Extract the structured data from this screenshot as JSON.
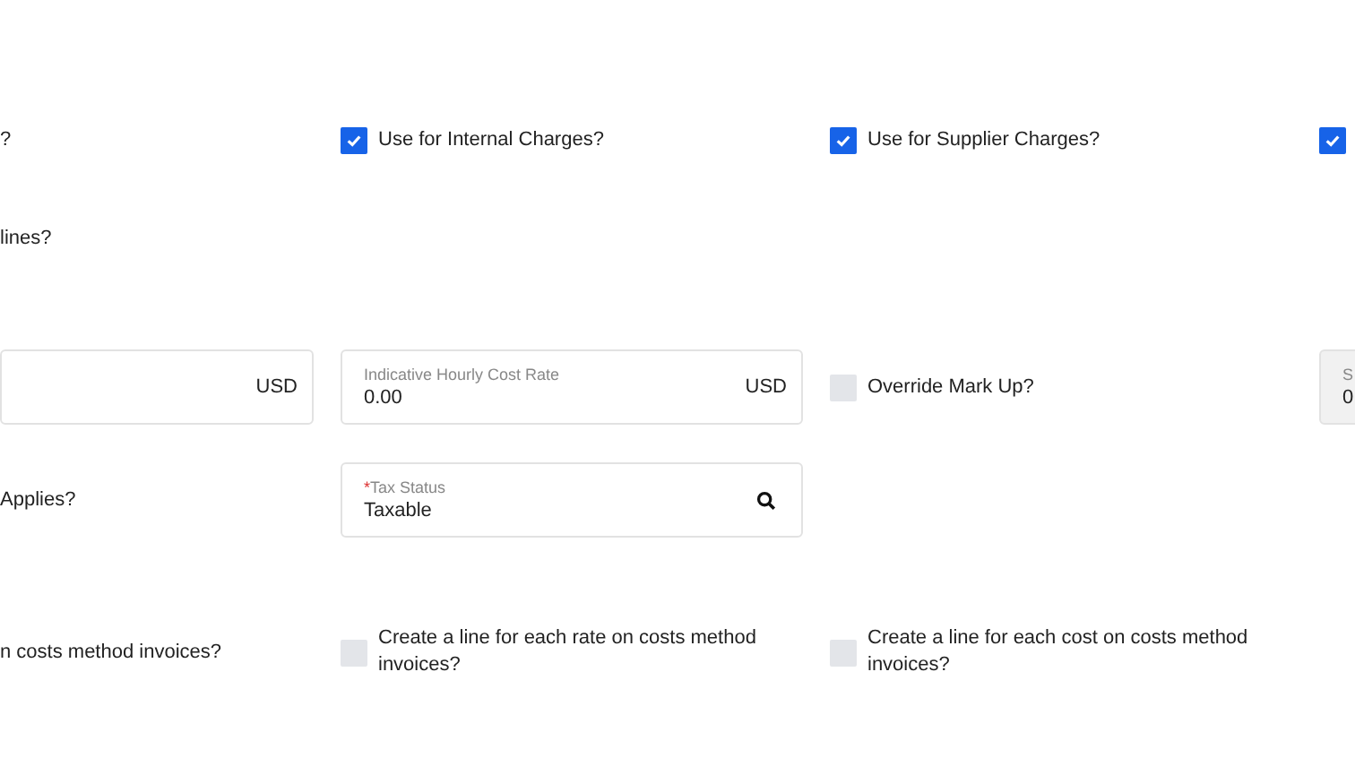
{
  "rows": [
    {
      "cells": [
        {
          "kind": "text",
          "text": "?"
        },
        {
          "kind": "checkbox",
          "checked": true,
          "label": "Use for Internal Charges?"
        },
        {
          "kind": "checkbox",
          "checked": true,
          "label": "Use for Supplier Charges?"
        },
        {
          "kind": "checkbox",
          "checked": true
        }
      ]
    },
    {
      "cells": [
        {
          "kind": "text",
          "text": "lines?"
        }
      ]
    },
    {
      "cells": [
        {
          "kind": "field",
          "suffix": "USD",
          "disabled": false
        },
        {
          "kind": "field",
          "label": "Indicative Hourly Cost Rate",
          "value": "0.00",
          "suffix": "USD",
          "disabled": false
        },
        {
          "kind": "checkbox",
          "checked": false,
          "label": "Override Mark Up?"
        },
        {
          "kind": "field",
          "label": "S",
          "value": "0",
          "disabled": true
        }
      ]
    },
    {
      "cells": [
        {
          "kind": "text",
          "text": "Applies?"
        },
        {
          "kind": "field",
          "label": "Tax Status",
          "required_mark": "*",
          "value": "Taxable",
          "search": true,
          "disabled": false
        }
      ]
    },
    {
      "cells": [
        {
          "kind": "text",
          "text": "n costs method invoices?"
        },
        {
          "kind": "checkbox",
          "checked": false,
          "label": "Create a line for each rate on costs method invoices?"
        },
        {
          "kind": "checkbox",
          "checked": false,
          "label": "Create a line for each cost on costs method invoices?"
        }
      ]
    }
  ]
}
